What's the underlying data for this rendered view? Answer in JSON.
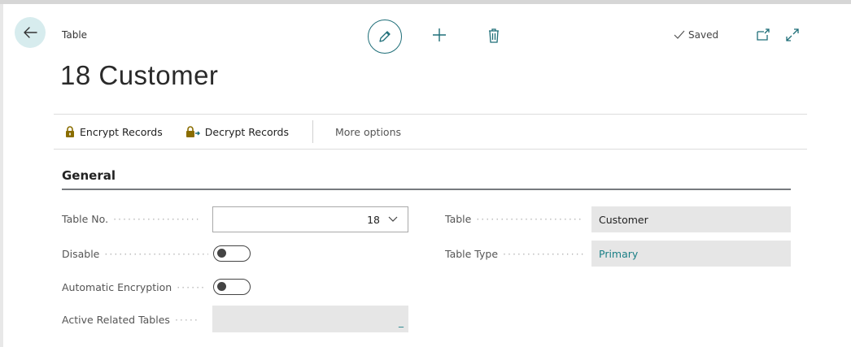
{
  "header": {
    "caption": "Table",
    "title": "18 Customer",
    "saved_label": "Saved"
  },
  "icons": {
    "back": "arrow-left-icon",
    "edit": "pencil-icon",
    "new": "plus-icon",
    "delete": "trash-icon",
    "saved": "checkmark-icon",
    "popout": "popout-icon",
    "expand": "expand-icon",
    "encrypt": "lock-icon",
    "decrypt": "unlock-icon",
    "toggle": "toggle-switch"
  },
  "actions": {
    "encrypt_label": "Encrypt Records",
    "decrypt_label": "Decrypt Records",
    "more_label": "More options"
  },
  "general": {
    "section_title": "General",
    "table_no_label": "Table No.",
    "table_no_value": "18",
    "disable_label": "Disable",
    "disable_on": false,
    "auto_enc_label": "Automatic Encryption",
    "auto_enc_on": false,
    "active_related_label": "Active Related Tables",
    "active_related_value": "_",
    "table_label": "Table",
    "table_value": "Customer",
    "table_type_label": "Table Type",
    "table_type_value": "Primary"
  },
  "colors": {
    "accent": "#1e6e78",
    "link": "#1a7f86",
    "back_bg": "#d7ecee",
    "lock_gold": "#8a6d00"
  }
}
